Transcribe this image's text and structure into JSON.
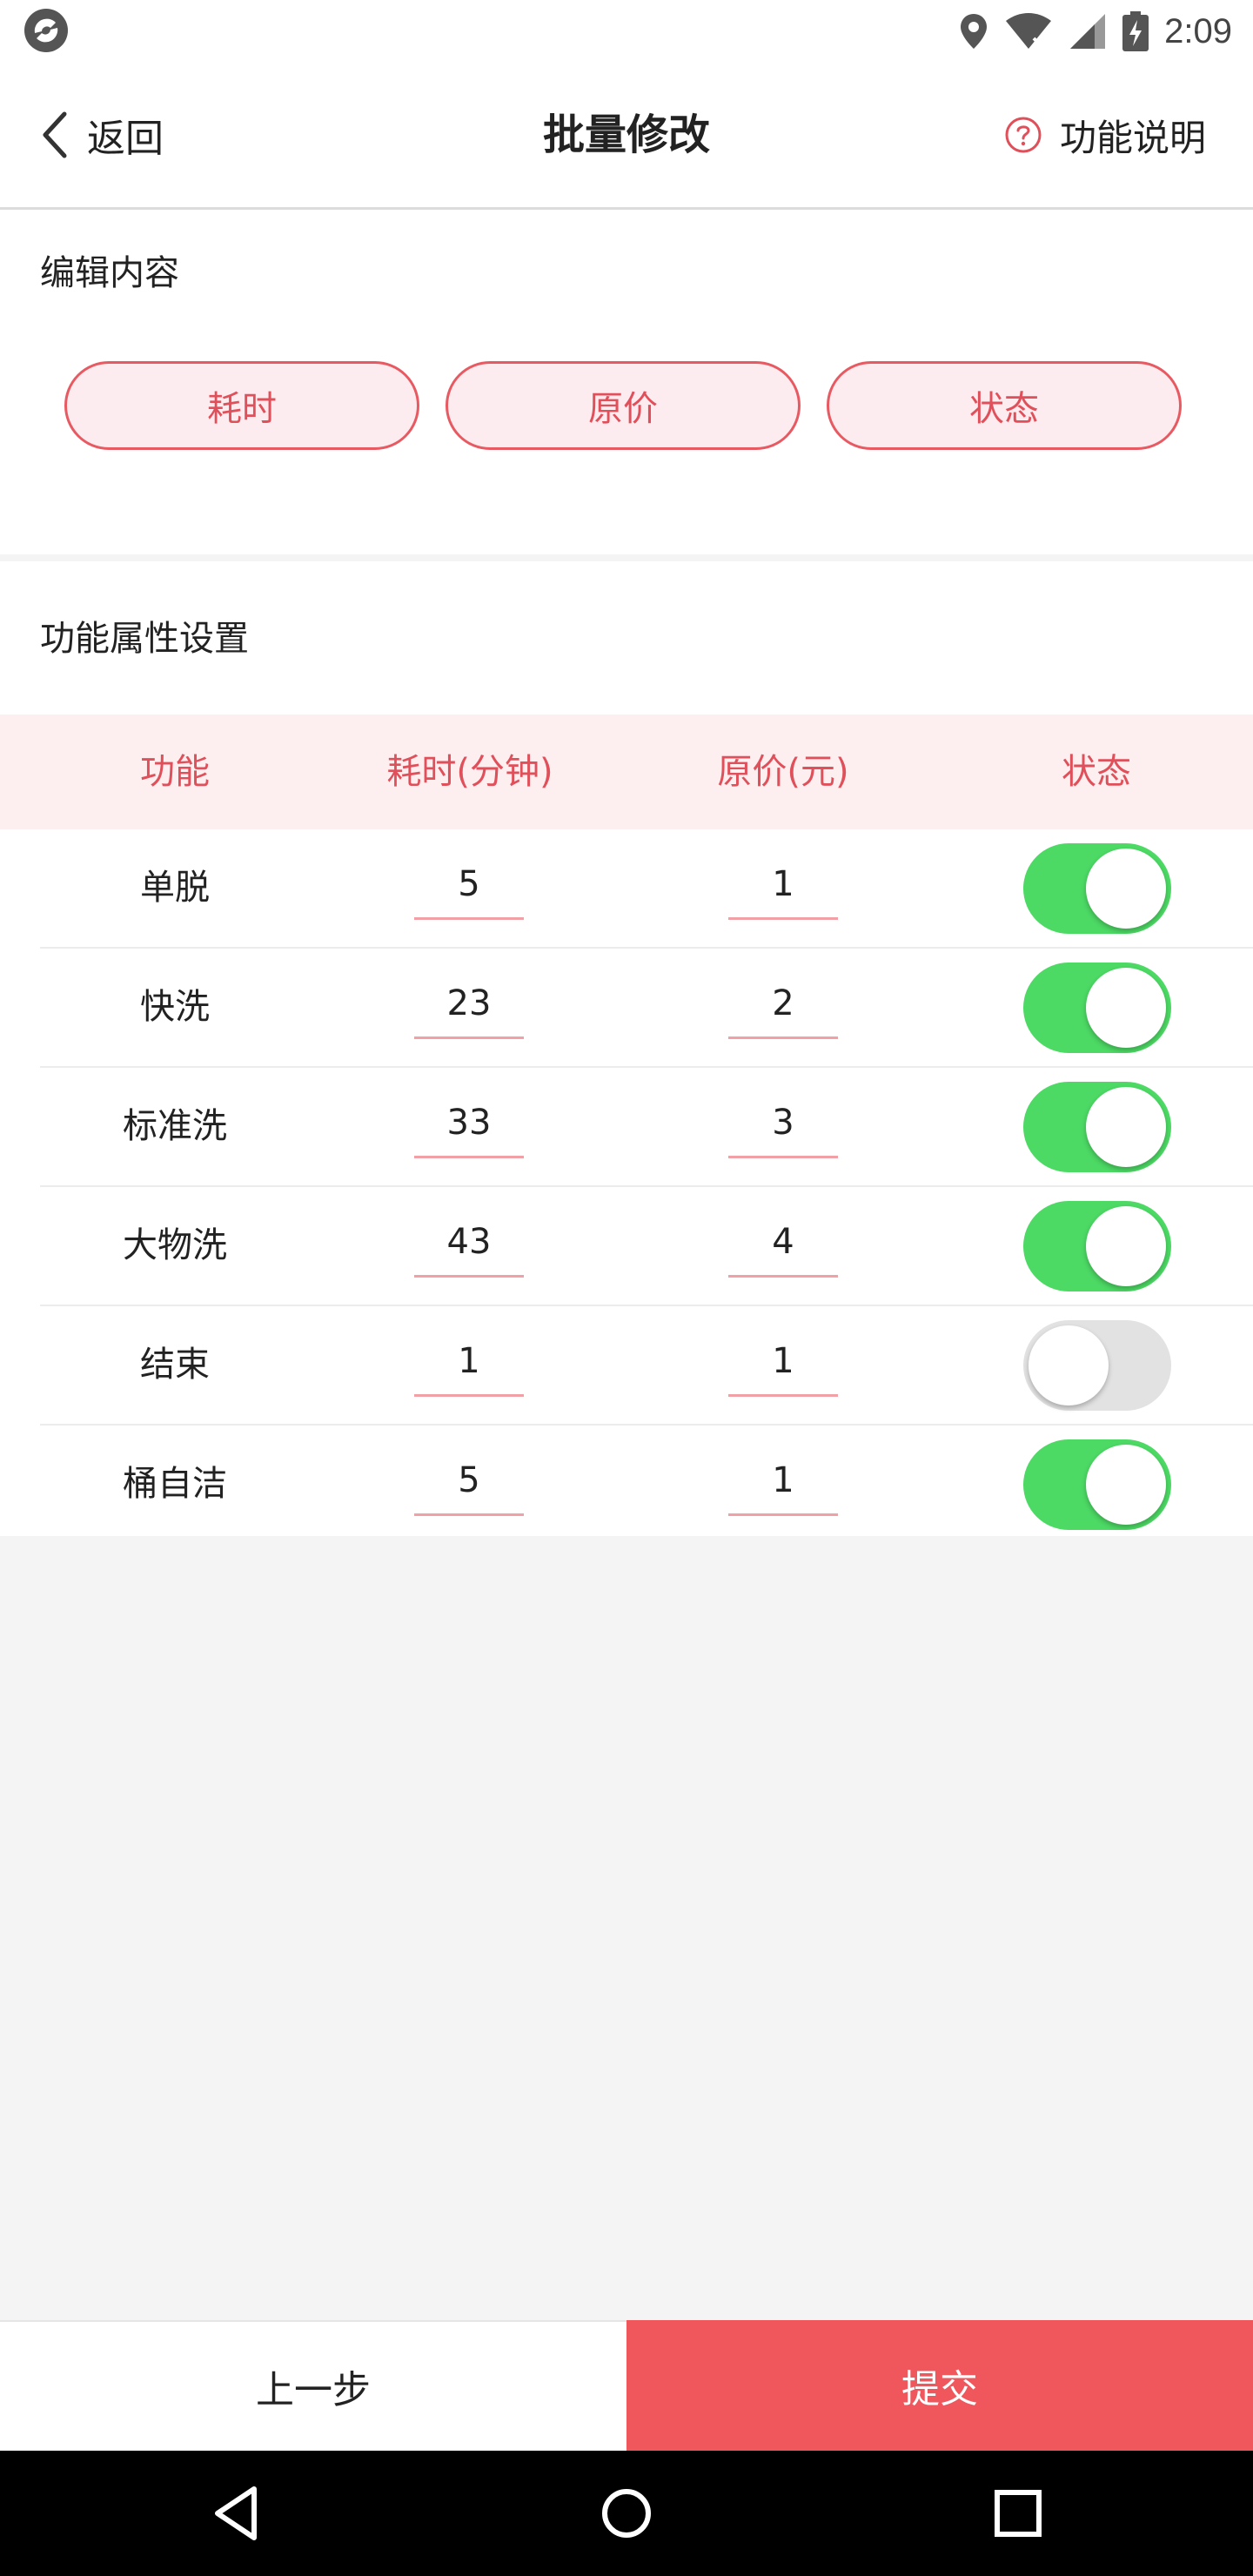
{
  "status_bar": {
    "time": "2:09",
    "icons": [
      "location-icon",
      "wifi-icon",
      "signal-icon",
      "battery-charging-icon"
    ]
  },
  "nav": {
    "back_label": "返回",
    "title": "批量修改",
    "help_label": "功能说明",
    "icons": {
      "back": "chevron-left-icon",
      "help": "question-circle-icon"
    }
  },
  "edit_section": {
    "title": "编辑内容",
    "options": [
      "耗时",
      "原价",
      "状态"
    ]
  },
  "attr_section": {
    "title": "功能属性设置",
    "columns": [
      "功能",
      "耗时(分钟)",
      "原价(元)",
      "状态"
    ],
    "rows": [
      {
        "name": "单脱",
        "time": "5",
        "price": "1",
        "enabled": true
      },
      {
        "name": "快洗",
        "time": "23",
        "price": "2",
        "enabled": true
      },
      {
        "name": "标准洗",
        "time": "33",
        "price": "3",
        "enabled": true
      },
      {
        "name": "大物洗",
        "time": "43",
        "price": "4",
        "enabled": true
      },
      {
        "name": "结束",
        "time": "1",
        "price": "1",
        "enabled": false
      },
      {
        "name": "桶自洁",
        "time": "5",
        "price": "1",
        "enabled": true
      }
    ]
  },
  "bottom": {
    "prev_label": "上一步",
    "submit_label": "提交"
  },
  "colors": {
    "accent": "#e0505a",
    "submit_bg": "#f0575c",
    "toggle_on": "#4cd964",
    "toggle_off": "#e2e2e2",
    "header_bg": "#fdeef0"
  },
  "system_nav": {
    "icons": [
      "back-triangle-icon",
      "home-circle-icon",
      "recents-square-icon"
    ]
  }
}
